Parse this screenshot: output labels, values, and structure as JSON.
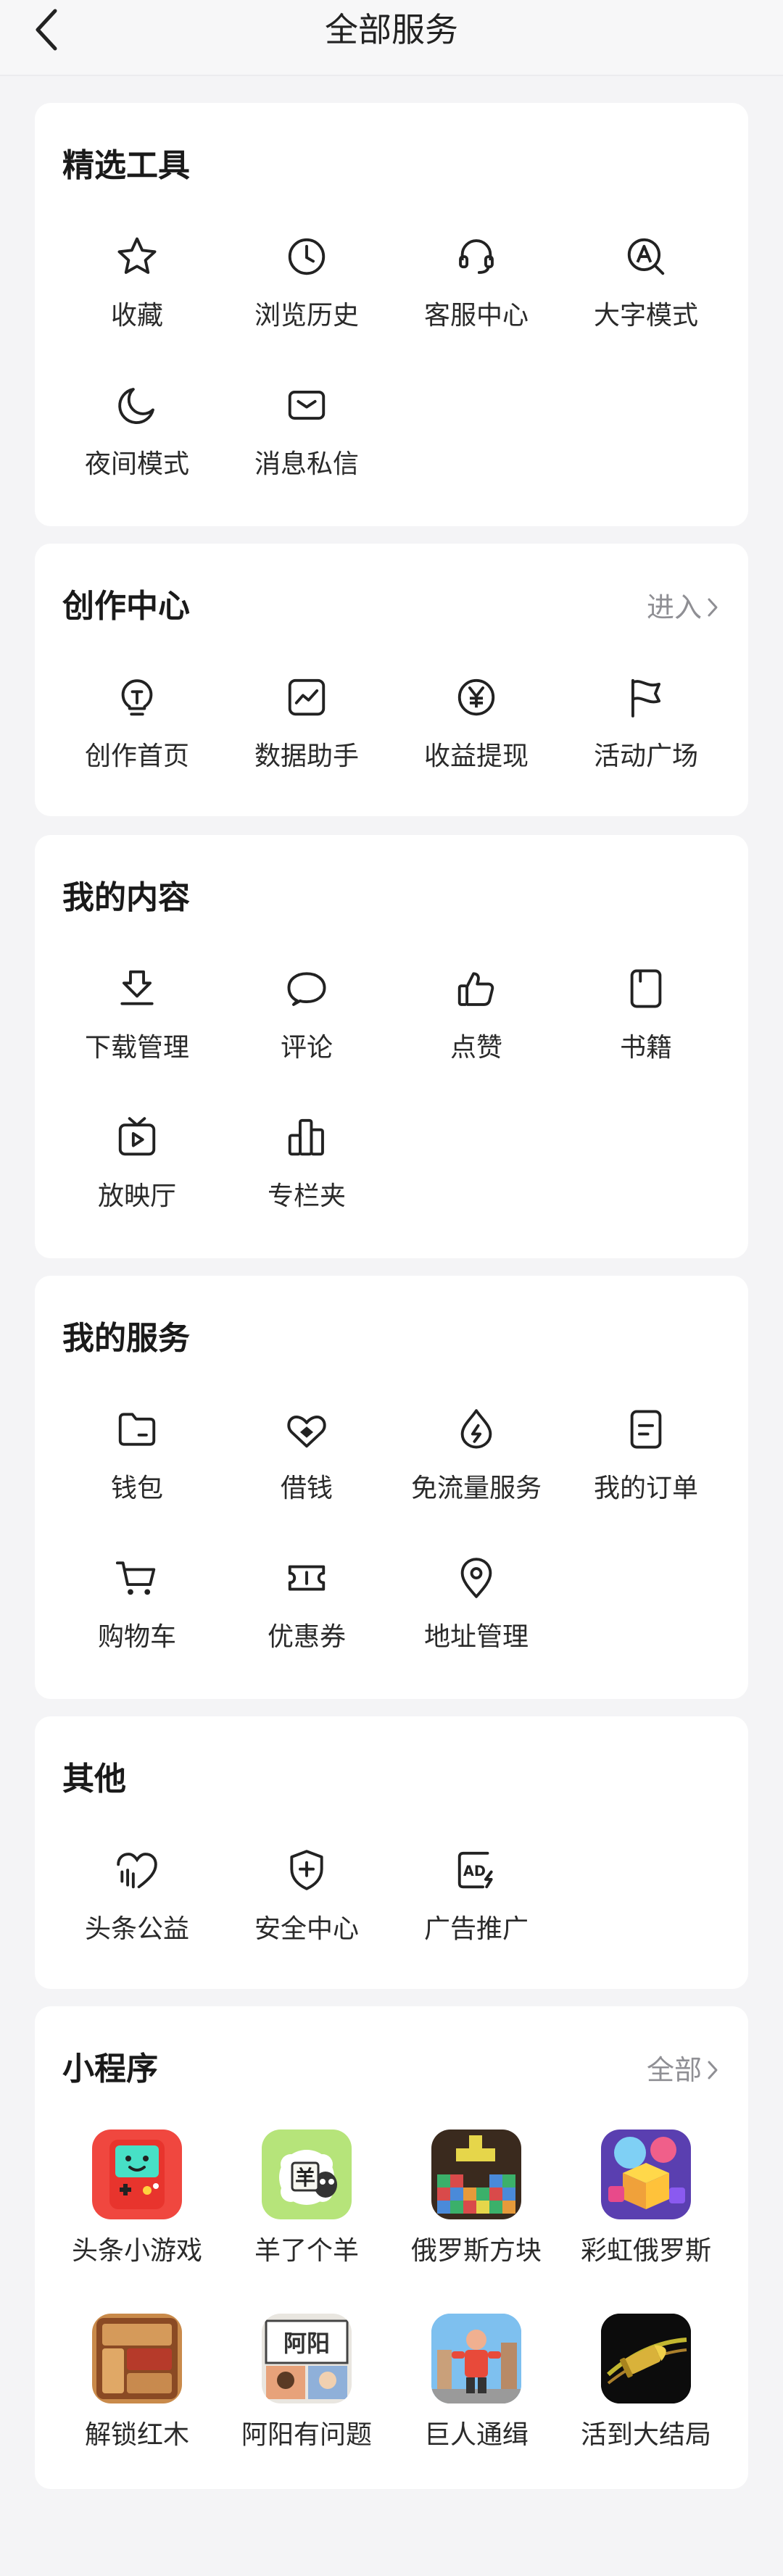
{
  "header": {
    "title": "全部服务"
  },
  "sections": {
    "tools": {
      "title": "精选工具",
      "items": [
        "收藏",
        "浏览历史",
        "客服中心",
        "大字模式",
        "夜间模式",
        "消息私信"
      ]
    },
    "creation": {
      "title": "创作中心",
      "more": "进入",
      "items": [
        "创作首页",
        "数据助手",
        "收益提现",
        "活动广场"
      ]
    },
    "content": {
      "title": "我的内容",
      "items": [
        "下载管理",
        "评论",
        "点赞",
        "书籍",
        "放映厅",
        "专栏夹"
      ]
    },
    "services": {
      "title": "我的服务",
      "items": [
        "钱包",
        "借钱",
        "免流量服务",
        "我的订单",
        "购物车",
        "优惠券",
        "地址管理"
      ]
    },
    "other": {
      "title": "其他",
      "items": [
        "头条公益",
        "安全中心",
        "广告推广"
      ]
    },
    "miniapps": {
      "title": "小程序",
      "more": "全部",
      "items": [
        "头条小游戏",
        "羊了个羊",
        "俄罗斯方块",
        "彩虹俄罗斯",
        "解锁红木",
        "阿阳有问题",
        "巨人通缉",
        "活到大结局"
      ]
    }
  },
  "icons": {
    "tools": [
      "star-icon",
      "clock-icon",
      "headset-icon",
      "magnifier-a-icon",
      "moon-icon",
      "envelope-icon"
    ],
    "creation": [
      "bulb-icon",
      "chart-icon",
      "yen-icon",
      "flag-icon"
    ],
    "content": [
      "download-icon",
      "comment-icon",
      "thumb-up-icon",
      "book-icon",
      "tv-icon",
      "bar-chart-icon"
    ],
    "services": [
      "folder-icon",
      "handshake-heart-icon",
      "drop-bolt-icon",
      "order-icon",
      "cart-icon",
      "coupon-icon",
      "location-pin-icon"
    ],
    "other": [
      "charity-heart-icon",
      "shield-plus-icon",
      "ad-icon"
    ]
  },
  "colors": {
    "accent_text": "#8f8f94",
    "card_bg": "#ffffff",
    "page_bg": "#f4f4f6"
  }
}
